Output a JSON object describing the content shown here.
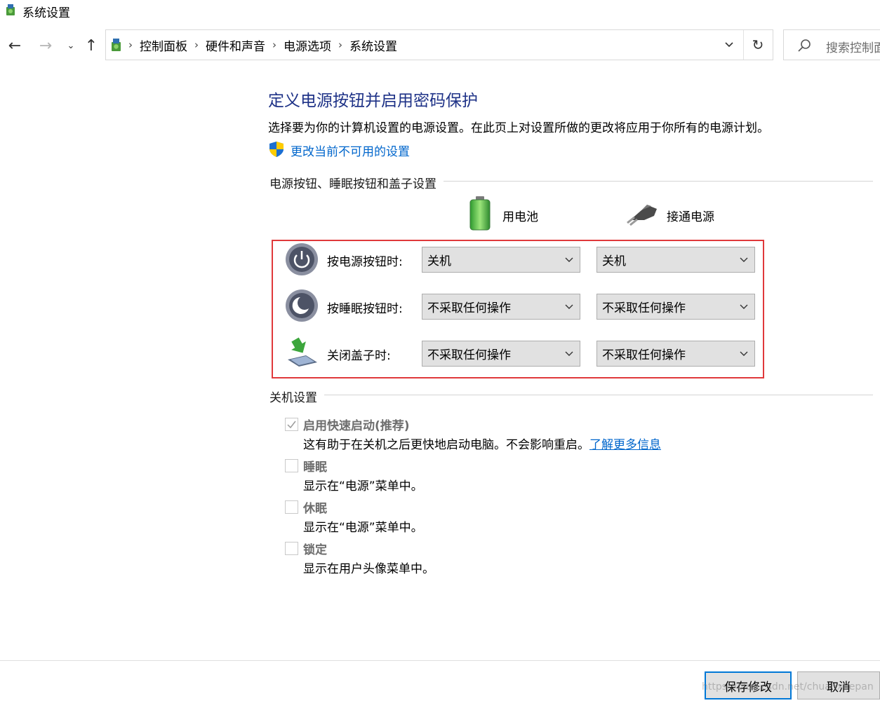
{
  "window": {
    "title": "系统设置"
  },
  "breadcrumbs": [
    "控制面板",
    "硬件和声音",
    "电源选项",
    "系统设置"
  ],
  "search": {
    "placeholder": "搜索控制面板"
  },
  "main": {
    "heading": "定义电源按钮并启用密码保护",
    "description": "选择要为你的计算机设置的电源设置。在此页上对设置所做的更改将应用于你所有的电源计划。",
    "change_settings_link": "更改当前不可用的设置",
    "buttons_group_title": "电源按钮、睡眠按钮和盖子设置",
    "columns": {
      "battery": "用电池",
      "plugged": "接通电源"
    },
    "rows": [
      {
        "label": "按电源按钮时:",
        "battery": "关机",
        "plugged": "关机",
        "icon": "power-button-icon"
      },
      {
        "label": "按睡眠按钮时:",
        "battery": "不采取任何操作",
        "plugged": "不采取任何操作",
        "icon": "sleep-button-icon"
      },
      {
        "label": "关闭盖子时:",
        "battery": "不采取任何操作",
        "plugged": "不采取任何操作",
        "icon": "laptop-lid-icon"
      }
    ],
    "shutdown_group_title": "关机设置",
    "shutdown_options": [
      {
        "label": "启用快速启动(推荐)",
        "desc": "这有助于在关机之后更快地启动电脑。不会影响重启。",
        "link": "了解更多信息",
        "checked": true
      },
      {
        "label": "睡眠",
        "desc": "显示在“电源”菜单中。",
        "checked": false
      },
      {
        "label": "休眠",
        "desc": "显示在“电源”菜单中。",
        "checked": false
      },
      {
        "label": "锁定",
        "desc": "显示在用户头像菜单中。",
        "checked": false
      }
    ]
  },
  "footer": {
    "save": "保存修改",
    "cancel": "取消"
  },
  "watermark": "https://blog.csdn.net/chuanxuepan",
  "colors": {
    "heading": "#1e3287",
    "link": "#0066cc",
    "highlight_box": "#e0393b",
    "primary_border": "#0078d7"
  }
}
